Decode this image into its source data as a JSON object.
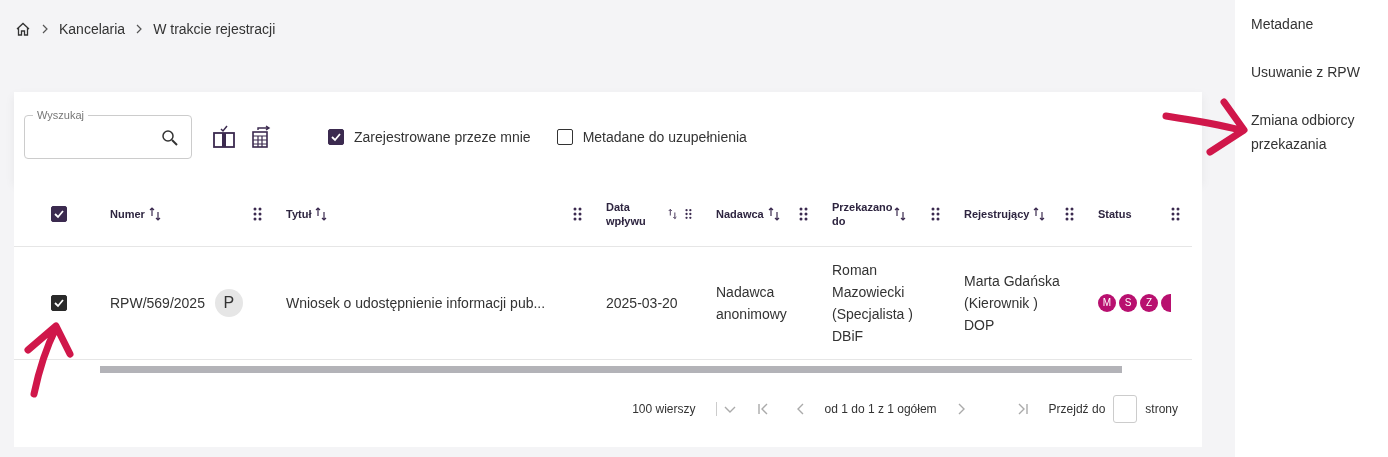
{
  "breadcrumb": [
    "Kancelaria",
    "W trakcie rejestracji"
  ],
  "search": {
    "label": "Wyszukaj"
  },
  "filters": [
    {
      "label": "Zarejestrowane przeze mnie",
      "checked": true
    },
    {
      "label": "Metadane do uzupełnienia",
      "checked": false
    }
  ],
  "table": {
    "all_selected": true,
    "columns": [
      {
        "label": "Numer",
        "sortable": true
      },
      {
        "label": "Tytuł",
        "sortable": true
      },
      {
        "label": "Data wpływu",
        "sortable": true
      },
      {
        "label": "Nadawca",
        "sortable": true
      },
      {
        "label": "Przekazano do",
        "sortable": true
      },
      {
        "label": "Rejestrujący",
        "sortable": true
      },
      {
        "label": "Status",
        "sortable": false
      }
    ],
    "rows": [
      {
        "selected": true,
        "numer": "RPW/569/2025",
        "type_badge": "P",
        "tytul": "Wniosek o udostępnienie informacji pub...",
        "data": "2025-03-20",
        "nadawca": "Nadawca anonimowy",
        "przekazano": "Roman Mazowiecki (Specjalista ) DBiF",
        "rejestrujacy": "Marta Gdańska (Kierownik ) DOP",
        "status": [
          {
            "letter": "M",
            "clipped": false
          },
          {
            "letter": "S",
            "clipped": false
          },
          {
            "letter": "Z",
            "clipped": false
          },
          {
            "clipped": true
          }
        ]
      }
    ]
  },
  "pagination": {
    "rows_per_page": "100 wierszy",
    "range": "od 1 do 1 z 1 ogółem",
    "goto_label": "Przejdź do",
    "goto_suffix": "strony"
  },
  "side_menu": [
    "Metadane",
    "Usuwanie z RPW",
    "Zmiana odbiorcy przekazania"
  ]
}
